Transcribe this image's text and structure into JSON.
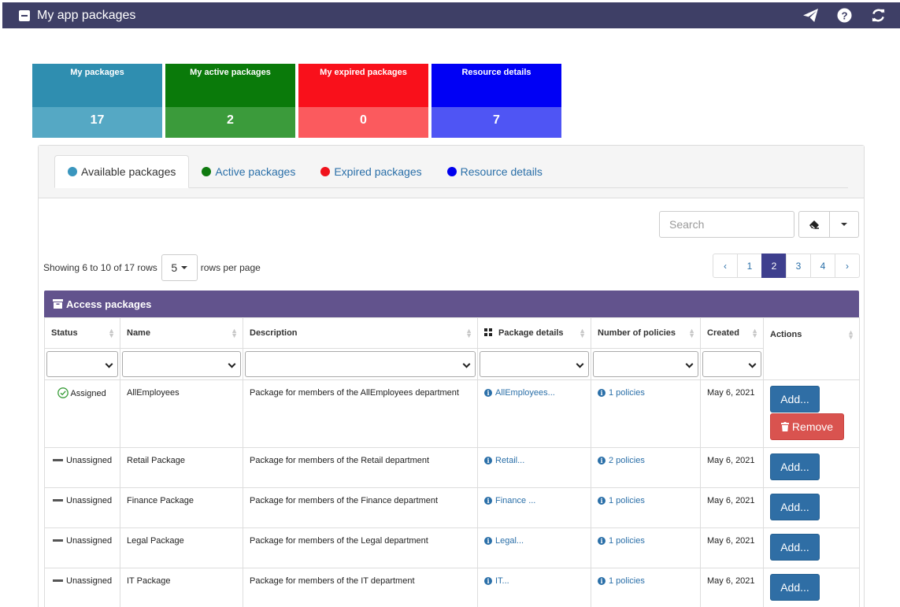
{
  "window": {
    "title": "My app packages"
  },
  "toolbar": {
    "icons": [
      "paper-plane-icon",
      "help-icon",
      "refresh-icon"
    ]
  },
  "tiles": [
    {
      "label": "My packages",
      "value": "17",
      "color_top": "#2f8eb0",
      "color_bottom": "#55a8c4"
    },
    {
      "label": "My active packages",
      "value": "2",
      "color_top": "#0a7a0a",
      "color_bottom": "#3b9b3b"
    },
    {
      "label": "My expired packages",
      "value": "0",
      "color_top": "#f9101b",
      "color_bottom": "#fb5a5e"
    },
    {
      "label": "Resource details",
      "value": "7",
      "color_top": "#0000f5",
      "color_bottom": "#4f55f4"
    }
  ],
  "tabs": [
    {
      "label": "Available packages",
      "dot": "#3a96be",
      "active": true
    },
    {
      "label": "Active packages",
      "dot": "#0f7a0f",
      "active": false
    },
    {
      "label": "Expired packages",
      "dot": "#f0121c",
      "active": false
    },
    {
      "label": "Resource details",
      "dot": "#0000ee",
      "active": false
    }
  ],
  "search": {
    "placeholder": "Search"
  },
  "paging": {
    "showing": "Showing 6 to 10 of 17 rows",
    "rows_per_page_value": "5",
    "rows_per_page_suffix": "rows per page",
    "prev": "‹",
    "next": "›",
    "pages": [
      "1",
      "2",
      "3",
      "4"
    ],
    "current_page": "2"
  },
  "table": {
    "title": "Access packages",
    "columns": [
      "Status",
      "Name",
      "Description",
      "Package details",
      "Number of policies",
      "Created",
      "Actions"
    ],
    "add_label": "Add...",
    "remove_label": "Remove",
    "rows": [
      {
        "status": "Assigned",
        "name": "AllEmployees",
        "description": "Package for members of the AllEmployees department",
        "details": "AllEmployees...",
        "policies": "1 policies",
        "created": "May 6, 2021",
        "removable": true
      },
      {
        "status": "Unassigned",
        "name": "Retail Package",
        "description": "Package for members of the Retail department",
        "details": "Retail...",
        "policies": "2 policies",
        "created": "May 6, 2021",
        "removable": false
      },
      {
        "status": "Unassigned",
        "name": "Finance Package",
        "description": "Package for members of the Finance department",
        "details": "Finance ...",
        "policies": "1 policies",
        "created": "May 6, 2021",
        "removable": false
      },
      {
        "status": "Unassigned",
        "name": "Legal Package",
        "description": "Package for members of the Legal department",
        "details": "Legal...",
        "policies": "1 policies",
        "created": "May 6, 2021",
        "removable": false
      },
      {
        "status": "Unassigned",
        "name": "IT Package",
        "description": "Package for members of the IT department",
        "details": "IT...",
        "policies": "1 policies",
        "created": "May 6, 2021",
        "removable": false
      }
    ]
  },
  "colors": {
    "titlebar": "#3e3f66",
    "table_header": "#62538d",
    "link": "#2a6fa8",
    "add_button": "#2f6ea5",
    "remove_button": "#d9534f",
    "pager_active": "#3e3f8e"
  }
}
